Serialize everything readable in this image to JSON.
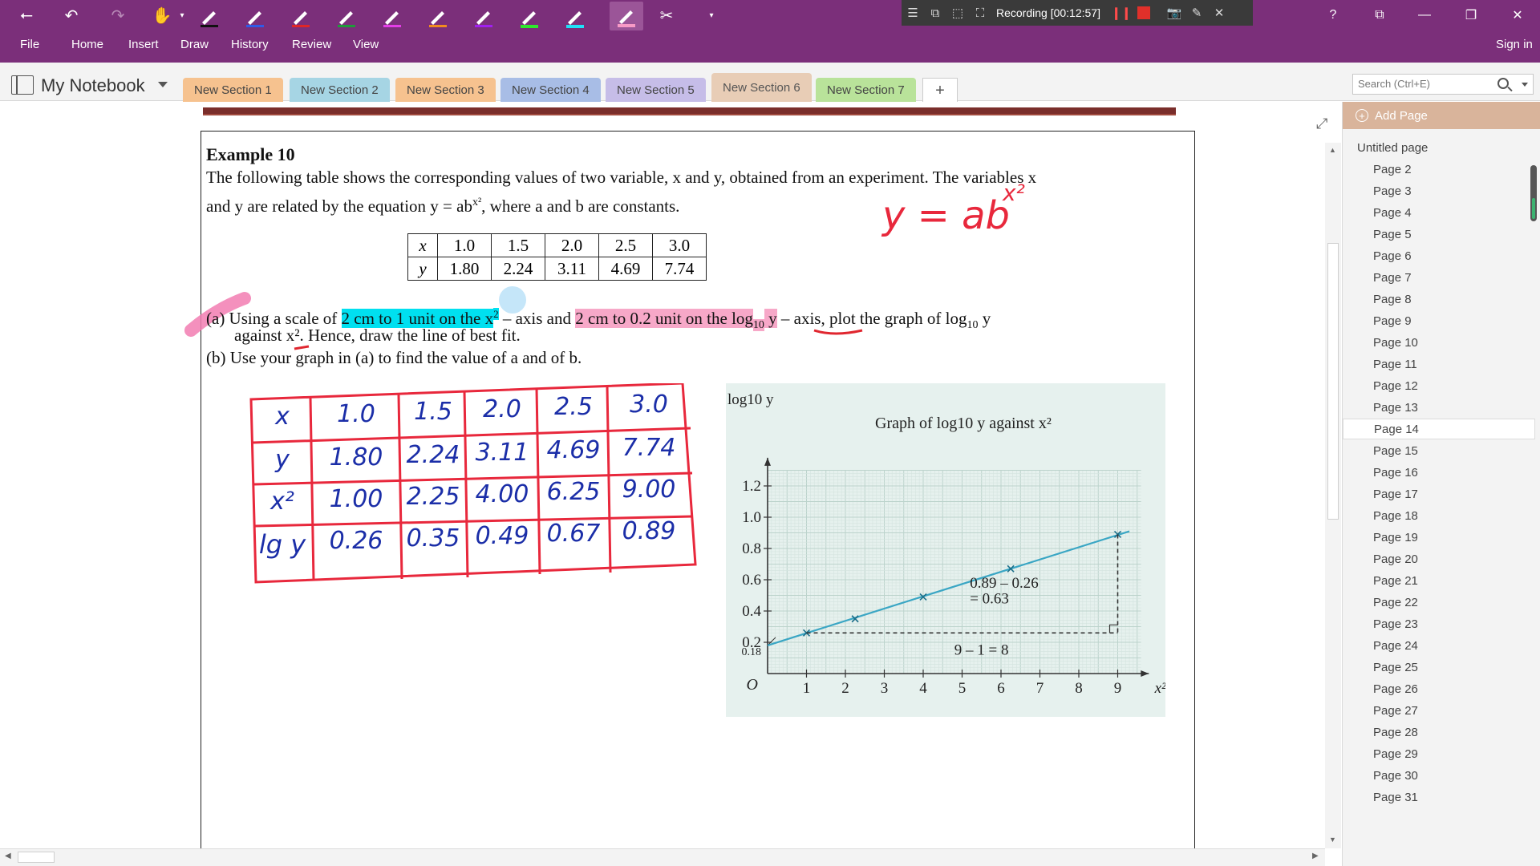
{
  "menus": [
    "File",
    "Home",
    "Insert",
    "Draw",
    "History",
    "Review",
    "View"
  ],
  "sign_in": "Sign in",
  "recording": {
    "label": "Recording [00:12:57]"
  },
  "notebook": {
    "title": "My Notebook"
  },
  "sections": [
    {
      "label": "New Section 1",
      "color": "#f6c28f"
    },
    {
      "label": "New Section 2",
      "color": "#a6d5e4"
    },
    {
      "label": "New Section 3",
      "color": "#f6c28f"
    },
    {
      "label": "New Section 4",
      "color": "#a8bde6"
    },
    {
      "label": "New Section 5",
      "color": "#c6bde8"
    },
    {
      "label": "New Section 6",
      "color": "#e8cdb6"
    },
    {
      "label": "New Section 7",
      "color": "#b9e39a"
    }
  ],
  "search": {
    "placeholder": "Search (Ctrl+E)"
  },
  "pages_pane": {
    "add_page": "Add Page",
    "pages": [
      "Untitled page",
      "Page 2",
      "Page 3",
      "Page 4",
      "Page 5",
      "Page 6",
      "Page 7",
      "Page 8",
      "Page 9",
      "Page 10",
      "Page 11",
      "Page 12",
      "Page 13",
      "Page 14",
      "Page 15",
      "Page 16",
      "Page 17",
      "Page 18",
      "Page 19",
      "Page 20",
      "Page 21",
      "Page 22",
      "Page 23",
      "Page 24",
      "Page 25",
      "Page 26",
      "Page 27",
      "Page 28",
      "Page 29",
      "Page 30",
      "Page 31"
    ],
    "selected": "Page 14"
  },
  "document": {
    "title": "Example 10",
    "line1": "The following table shows the corresponding values of two variable, x and y, obtained from an experiment. The variables x",
    "line2_pre": "and y are related by the equation y = ab",
    "line2_post": ", where a and b are constants.",
    "table": {
      "x_label": "x",
      "y_label": "y",
      "x": [
        "1.0",
        "1.5",
        "2.0",
        "2.5",
        "3.0"
      ],
      "y": [
        "1.80",
        "2.24",
        "3.11",
        "4.69",
        "7.74"
      ]
    },
    "qa_pre": "(a) Using a scale of",
    "qa_hl1": "2 cm to 1 unit",
    "qa_mid": " on the x",
    "qa_mid2": " – axis and ",
    "qa_hl2": "2 cm to 0.2 unit on the log",
    "qa_hl2b": " y",
    "qa_post": " – axis, plot the graph of log",
    "qa_post2": " y",
    "qa_line2": "against x². Hence, draw the line of best fit.",
    "qb": "(b) Use your graph in (a) to find the value of a and of b.",
    "handwritten_eq": "y = ab",
    "handwritten_table": {
      "rows": [
        {
          "label": "x",
          "values": [
            "1.0",
            "1.5",
            "2.0",
            "2.5",
            "3.0"
          ]
        },
        {
          "label": "y",
          "values": [
            "1.80",
            "2.24",
            "3.11",
            "4.69",
            "7.74"
          ]
        },
        {
          "label": "x²",
          "values": [
            "1.00",
            "2.25",
            "4.00",
            "6.25",
            "9.00"
          ]
        },
        {
          "label": "lg y",
          "values": [
            "0.26",
            "0.35",
            "0.49",
            "0.67",
            "0.89"
          ]
        }
      ]
    }
  },
  "chart_data": {
    "type": "line",
    "title": "Graph of log10 y against x²",
    "xlabel": "x²",
    "ylabel": "log10 y",
    "origin_label": "O",
    "x_ticks": [
      "1",
      "2",
      "3",
      "4",
      "5",
      "6",
      "7",
      "8",
      "9"
    ],
    "y_ticks": [
      "0.2",
      "0.4",
      "0.6",
      "0.8",
      "1.0",
      "1.2"
    ],
    "intercept_label": "0.18",
    "xlim": [
      0,
      10
    ],
    "ylim": [
      0,
      1.3
    ],
    "grid": true,
    "series": [
      {
        "x": [
          1.0,
          2.25,
          4.0,
          6.25,
          9.0
        ],
        "y": [
          0.26,
          0.35,
          0.49,
          0.67,
          0.89
        ]
      }
    ],
    "best_fit": {
      "x": [
        0,
        9.3
      ],
      "y": [
        0.18,
        0.91
      ]
    },
    "annotations": {
      "rise_line1": "0.89 – 0.26",
      "rise_line2": "= 0.63",
      "run": "9 – 1 = 8"
    },
    "line_color": "#3aa6c4"
  }
}
